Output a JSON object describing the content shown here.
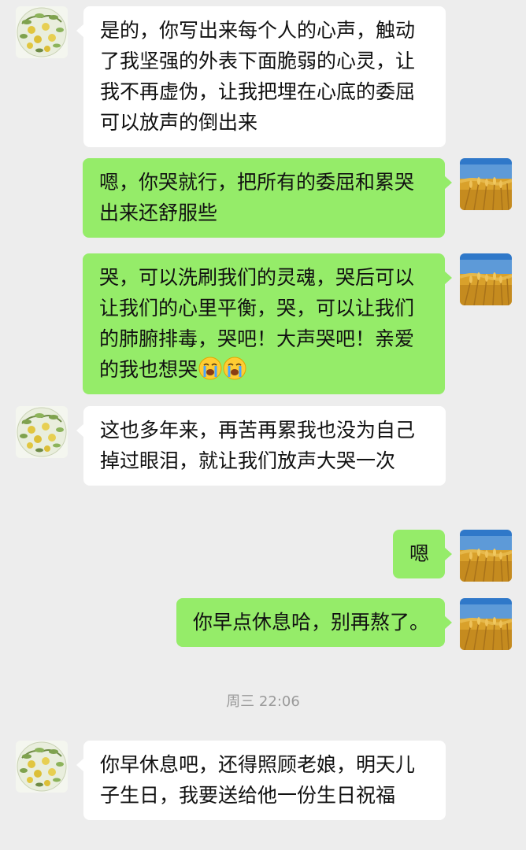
{
  "messages": [
    {
      "side": "left",
      "text": "是的，你写出来每个人的心声，触动了我坚强的外表下面脆弱的心灵，让我不再虚伪，让我把埋在心底的委屈可以放声的倒出来"
    },
    {
      "side": "right",
      "text": "嗯，你哭就行，把所有的委屈和累哭出来还舒服些"
    },
    {
      "side": "right",
      "text": "哭，可以洗刷我们的灵魂，哭后可以让我们的心里平衡，哭，可以让我们的肺腑排毒，哭吧！大声哭吧！亲爱的我也想哭",
      "emoji": [
        "loudly-crying-face-icon",
        "loudly-crying-face-icon"
      ]
    },
    {
      "side": "left",
      "text": "这也多年来，再苦再累我也没为自己掉过眼泪，就让我们放声大哭一次"
    },
    {
      "side": "right",
      "text": "嗯"
    },
    {
      "side": "right",
      "text": "你早点休息哈，别再熬了。"
    },
    {
      "side": "left",
      "text": "你早休息吧，还得照顾老娘，明天儿子生日，我要送给他一份生日祝福"
    }
  ],
  "timestamp": "周三 22:06",
  "colors": {
    "background": "#ededed",
    "incoming_bubble": "#ffffff",
    "outgoing_bubble": "#95ec69",
    "timestamp_text": "#9a9a9a"
  },
  "avatars": {
    "contact": "pear-tree-avatar-icon",
    "self": "wheat-field-avatar-icon"
  }
}
